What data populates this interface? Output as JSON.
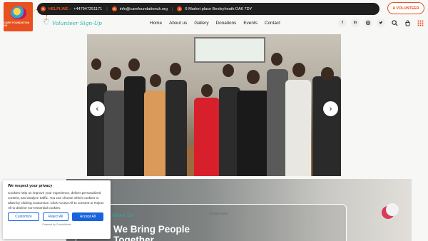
{
  "brand": {
    "logo_caption": "CARE FOUNDATION UK",
    "tagline": "Volunteer Sign-Up"
  },
  "topbar": {
    "helpline_label": "HELPLINE :",
    "helpline_number": "+447947251171",
    "email": "info@carefoundationuk.org",
    "address": "6 Market place Bexleyheath DA6 7DY",
    "volunteer_button": "A VOLUNTEER"
  },
  "nav": {
    "items": [
      "Home",
      "About us",
      "Gallery",
      "Donations",
      "Events",
      "Contact"
    ]
  },
  "social": {
    "facebook": "f",
    "linkedin": "in",
    "instagram": "ig",
    "twitter": "tw"
  },
  "slider": {
    "prev": "‹",
    "next": "›"
  },
  "lower": {
    "kicker": "About Us",
    "headline_line1": "We Bring People",
    "headline_line2": "Together",
    "card_title": "Coming Home"
  },
  "cookie": {
    "title": "We respect your privacy",
    "body": "Cookies help us improve your experience, deliver personalized content, and analyze traffic. You can choose which cookies to allow by clicking Customize. Click Accept All to consent or Reject All to decline non-essential cookies.",
    "customize": "Customize",
    "reject": "Reject All",
    "accept": "Accept All",
    "powered": "Powered by CookieAdmin"
  },
  "colors": {
    "accent": "#e8501f",
    "teal": "#24b3a8",
    "cookie_blue": "#1863dc"
  }
}
